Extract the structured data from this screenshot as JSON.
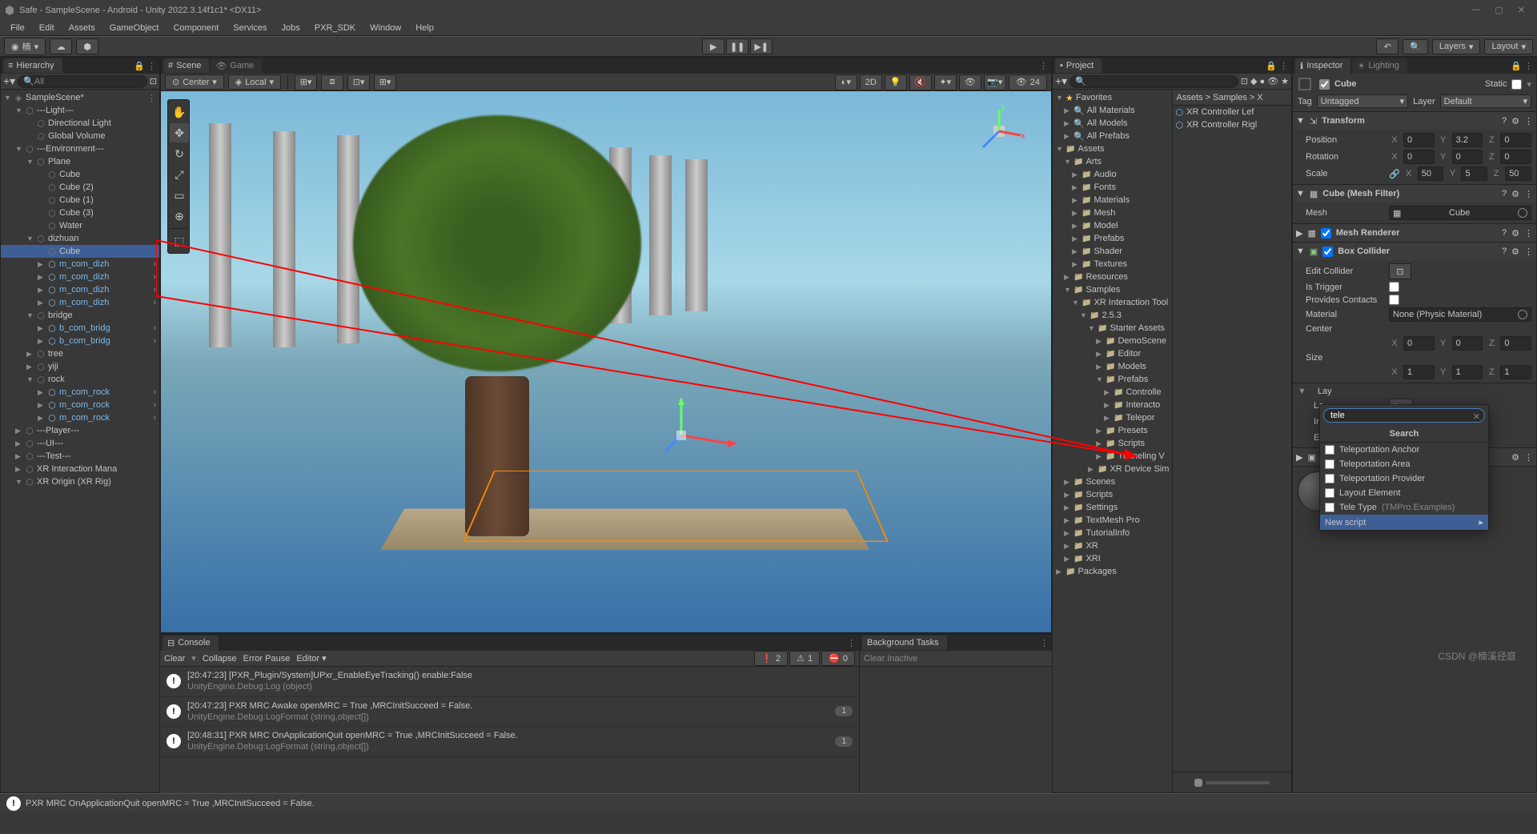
{
  "titlebar": {
    "text": "Safe - SampleScene - Android - Unity 2022.3.14f1c1* <DX11>"
  },
  "menubar": [
    "File",
    "Edit",
    "Assets",
    "GameObject",
    "Component",
    "Services",
    "Jobs",
    "PXR_SDK",
    "Window",
    "Help"
  ],
  "toolbar": {
    "account": "楠",
    "search_icon": "🔍",
    "layers": "Layers",
    "layout": "Layout"
  },
  "hierarchy": {
    "tab": "Hierarchy",
    "search": "All",
    "scene": "SampleScene*",
    "items": [
      {
        "depth": 1,
        "name": "---Light---",
        "expand": "▼"
      },
      {
        "depth": 2,
        "name": "Directional Light",
        "expand": ""
      },
      {
        "depth": 2,
        "name": "Global Volume",
        "expand": ""
      },
      {
        "depth": 1,
        "name": "---Environment---",
        "expand": "▼"
      },
      {
        "depth": 2,
        "name": "Plane",
        "expand": "▼"
      },
      {
        "depth": 3,
        "name": "Cube",
        "expand": ""
      },
      {
        "depth": 3,
        "name": "Cube (2)",
        "expand": ""
      },
      {
        "depth": 3,
        "name": "Cube (1)",
        "expand": ""
      },
      {
        "depth": 3,
        "name": "Cube (3)",
        "expand": ""
      },
      {
        "depth": 3,
        "name": "Water",
        "expand": ""
      },
      {
        "depth": 2,
        "name": "dizhuan",
        "expand": "▼"
      },
      {
        "depth": 3,
        "name": "Cube",
        "expand": "",
        "selected": true
      },
      {
        "depth": 3,
        "name": "m_com_dizh",
        "expand": "▶",
        "prefab": true,
        "arrow": true
      },
      {
        "depth": 3,
        "name": "m_com_dizh",
        "expand": "▶",
        "prefab": true,
        "arrow": true
      },
      {
        "depth": 3,
        "name": "m_com_dizh",
        "expand": "▶",
        "prefab": true,
        "arrow": true
      },
      {
        "depth": 3,
        "name": "m_com_dizh",
        "expand": "▶",
        "prefab": true,
        "arrow": true
      },
      {
        "depth": 2,
        "name": "bridge",
        "expand": "▼"
      },
      {
        "depth": 3,
        "name": "b_com_bridg",
        "expand": "▶",
        "prefab": true,
        "arrow": true
      },
      {
        "depth": 3,
        "name": "b_com_bridg",
        "expand": "▶",
        "prefab": true,
        "arrow": true
      },
      {
        "depth": 2,
        "name": "tree",
        "expand": "▶"
      },
      {
        "depth": 2,
        "name": "yiji",
        "expand": "▶"
      },
      {
        "depth": 2,
        "name": "rock",
        "expand": "▼"
      },
      {
        "depth": 3,
        "name": "m_com_rock",
        "expand": "▶",
        "prefab": true,
        "arrow": true
      },
      {
        "depth": 3,
        "name": "m_com_rock",
        "expand": "▶",
        "prefab": true,
        "arrow": true
      },
      {
        "depth": 3,
        "name": "m_com_rock",
        "expand": "▶",
        "prefab": true,
        "arrow": true
      },
      {
        "depth": 1,
        "name": "---Player---",
        "expand": "▶"
      },
      {
        "depth": 1,
        "name": "---UI---",
        "expand": "▶"
      },
      {
        "depth": 1,
        "name": "---Test---",
        "expand": "▶"
      },
      {
        "depth": 1,
        "name": "XR Interaction Mana",
        "expand": "▶"
      },
      {
        "depth": 1,
        "name": "XR Origin (XR Rig)",
        "expand": "▼"
      }
    ]
  },
  "scene": {
    "tab_scene": "Scene",
    "tab_game": "Game",
    "pivot": "Center",
    "space": "Local",
    "mode_2d": "2D",
    "gizmo_count": "24"
  },
  "console": {
    "tab": "Console",
    "clear": "Clear",
    "collapse": "Collapse",
    "error_pause": "Error Pause",
    "editor": "Editor ▾",
    "counts": {
      "info": "2",
      "warn": "1",
      "error": "0"
    },
    "entries": [
      {
        "line1": "[20:47:23] [PXR_Plugin/System]UPxr_EnableEyeTracking() enable:False",
        "line2": "UnityEngine.Debug:Log (object)",
        "count": ""
      },
      {
        "line1": "[20:47:23] PXR MRC Awake openMRC = True ,MRCInitSucceed = False.",
        "line2": "UnityEngine.Debug:LogFormat (string,object[])",
        "count": "1"
      },
      {
        "line1": "[20:48:31] PXR MRC OnApplicationQuit openMRC = True ,MRCInitSucceed = False.",
        "line2": "UnityEngine.Debug:LogFormat (string,object[])",
        "count": "1"
      }
    ]
  },
  "bgtasks": {
    "tab": "Background Tasks",
    "clear": "Clear Inactive"
  },
  "statusbar": {
    "text": "PXR MRC OnApplicationQuit openMRC = True ,MRCInitSucceed = False."
  },
  "project": {
    "tab": "Project",
    "breadcrumb": "Assets > Samples > X",
    "list_items": [
      "XR Controller Lef",
      "XR Controller Rigl"
    ],
    "tree": [
      {
        "d": 0,
        "n": "Favorites",
        "e": "▼",
        "star": true
      },
      {
        "d": 1,
        "n": "All Materials",
        "e": "",
        "search": true
      },
      {
        "d": 1,
        "n": "All Models",
        "e": "",
        "search": true
      },
      {
        "d": 1,
        "n": "All Prefabs",
        "e": "",
        "search": true
      },
      {
        "d": 0,
        "n": "Assets",
        "e": "▼"
      },
      {
        "d": 1,
        "n": "Arts",
        "e": "▼"
      },
      {
        "d": 2,
        "n": "Audio",
        "e": "▶"
      },
      {
        "d": 2,
        "n": "Fonts",
        "e": "▶"
      },
      {
        "d": 2,
        "n": "Materials",
        "e": "▶"
      },
      {
        "d": 2,
        "n": "Mesh",
        "e": "▶"
      },
      {
        "d": 2,
        "n": "Model",
        "e": "▶"
      },
      {
        "d": 2,
        "n": "Prefabs",
        "e": "▶"
      },
      {
        "d": 2,
        "n": "Shader",
        "e": "▶"
      },
      {
        "d": 2,
        "n": "Textures",
        "e": "▶"
      },
      {
        "d": 1,
        "n": "Resources",
        "e": "▶"
      },
      {
        "d": 1,
        "n": "Samples",
        "e": "▼"
      },
      {
        "d": 2,
        "n": "XR Interaction Tool",
        "e": "▼"
      },
      {
        "d": 3,
        "n": "2.5.3",
        "e": "▼"
      },
      {
        "d": 4,
        "n": "Starter Assets",
        "e": "▼"
      },
      {
        "d": 5,
        "n": "DemoScene",
        "e": "▶"
      },
      {
        "d": 5,
        "n": "Editor",
        "e": "▶"
      },
      {
        "d": 5,
        "n": "Models",
        "e": "▶"
      },
      {
        "d": 5,
        "n": "Prefabs",
        "e": "▼"
      },
      {
        "d": 6,
        "n": "Controlle",
        "e": "▶"
      },
      {
        "d": 6,
        "n": "Interacto",
        "e": "▶"
      },
      {
        "d": 6,
        "n": "Telepor",
        "e": "▶"
      },
      {
        "d": 5,
        "n": "Presets",
        "e": "▶"
      },
      {
        "d": 5,
        "n": "Scripts",
        "e": "▶"
      },
      {
        "d": 5,
        "n": "Tunneling V",
        "e": "▶"
      },
      {
        "d": 4,
        "n": "XR Device Sim",
        "e": "▶"
      },
      {
        "d": 1,
        "n": "Scenes",
        "e": "▶"
      },
      {
        "d": 1,
        "n": "Scripts",
        "e": "▶"
      },
      {
        "d": 1,
        "n": "Settings",
        "e": "▶"
      },
      {
        "d": 1,
        "n": "TextMesh Pro",
        "e": "▶"
      },
      {
        "d": 1,
        "n": "TutorialInfo",
        "e": "▶"
      },
      {
        "d": 1,
        "n": "XR",
        "e": "▶"
      },
      {
        "d": 1,
        "n": "XRI",
        "e": "▶"
      },
      {
        "d": 0,
        "n": "Packages",
        "e": "▶"
      }
    ]
  },
  "inspector": {
    "tab_inspector": "Inspector",
    "tab_lighting": "Lighting",
    "obj_name": "Cube",
    "static_label": "Static",
    "tag_label": "Tag",
    "tag_value": "Untagged",
    "layer_label": "Layer",
    "layer_value": "Default",
    "transform": {
      "title": "Transform",
      "pos": {
        "label": "Position",
        "x": "0",
        "y": "3.2",
        "z": "0"
      },
      "rot": {
        "label": "Rotation",
        "x": "0",
        "y": "0",
        "z": "0"
      },
      "scale": {
        "label": "Scale",
        "x": "50",
        "y": "5",
        "z": "50"
      }
    },
    "mesh_filter": {
      "title": "Cube (Mesh Filter)",
      "mesh_label": "Mesh",
      "mesh_value": "Cube"
    },
    "mesh_renderer": {
      "title": "Mesh Renderer"
    },
    "box_collider": {
      "title": "Box Collider",
      "edit": "Edit Collider",
      "trigger": "Is Trigger",
      "contacts": "Provides Contacts",
      "material": "Material",
      "material_val": "None (Physic Material)",
      "center": "Center",
      "center_v": {
        "x": "0",
        "y": "0",
        "z": "0"
      },
      "size": "Size",
      "size_v": {
        "x": "1",
        "y": "1",
        "z": "1"
      }
    },
    "lay_label": "Lay",
    "la_label": "La",
    "in_label": "In",
    "ex_label": "Ex"
  },
  "popup": {
    "search_value": "tele",
    "title": "Search",
    "items": [
      "Teleportation Anchor",
      "Teleportation Area",
      "Teleportation Provider",
      "Layout Element"
    ],
    "tele_type": "Tele Type",
    "tele_type_sub": "(TMPro.Examples)",
    "new_script": "New script"
  },
  "watermark": "CSDN @楠溪径庭"
}
